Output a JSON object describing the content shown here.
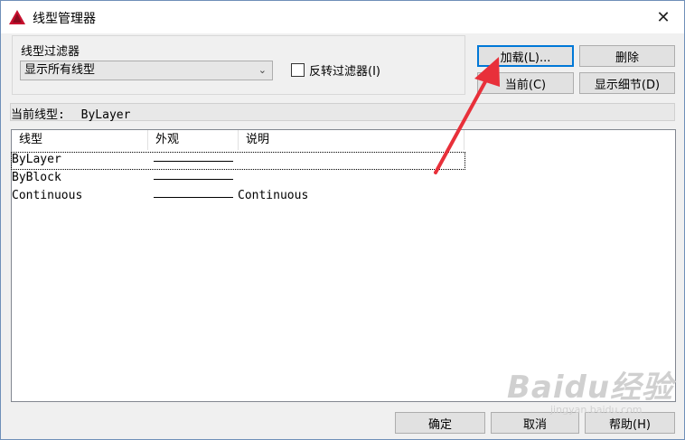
{
  "window": {
    "title": "线型管理器",
    "close_label": "✕"
  },
  "filter": {
    "group_label": "线型过滤器",
    "selected": "显示所有线型",
    "invert_label": "反转过滤器(I)",
    "invert_checked": false
  },
  "buttons": {
    "load": "加载(L)...",
    "delete": "删除",
    "current": "当前(C)",
    "show_details": "显示细节(D)",
    "ok": "确定",
    "cancel": "取消",
    "help": "帮助(H)"
  },
  "current_linetype": {
    "label": "当前线型:",
    "value": "ByLayer"
  },
  "list": {
    "columns": [
      "线型",
      "外观",
      "说明"
    ],
    "rows": [
      {
        "name": "ByLayer",
        "description": "",
        "selected": true
      },
      {
        "name": "ByBlock",
        "description": "",
        "selected": false
      },
      {
        "name": "Continuous",
        "description": "Continuous",
        "selected": false
      }
    ]
  },
  "watermark": {
    "brand": "Baidu经验",
    "url": "jingyan.baidu.com"
  },
  "colors": {
    "arrow": "#e8303a",
    "focus": "#0078d7",
    "app_icon": "#c8102e"
  }
}
